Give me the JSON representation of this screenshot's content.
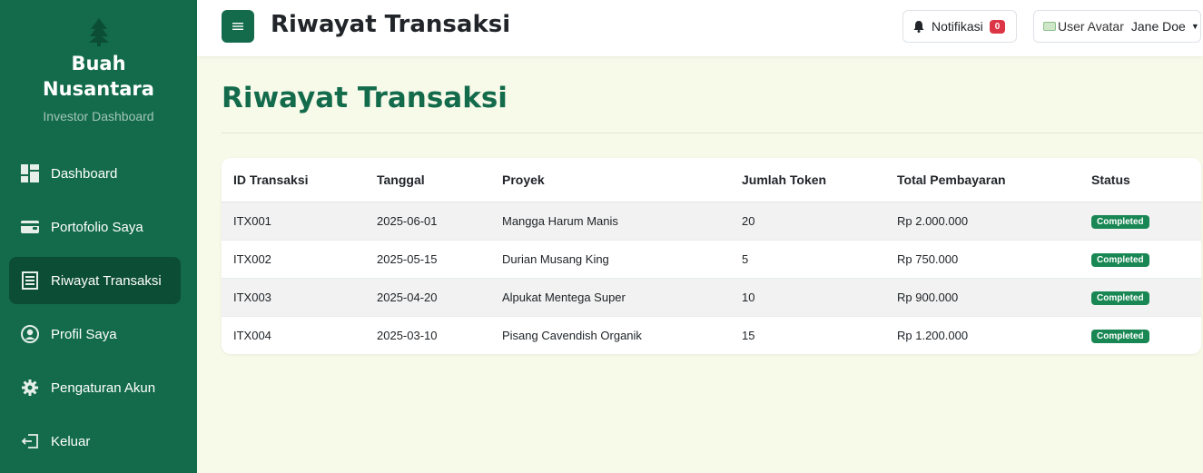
{
  "sidebar": {
    "brand_line1": "Buah",
    "brand_line2": "Nusantara",
    "brand_sub": "Investor Dashboard",
    "items": [
      {
        "label": "Dashboard",
        "icon": "dashboard-icon"
      },
      {
        "label": "Portofolio Saya",
        "icon": "wallet-icon"
      },
      {
        "label": "Riwayat Transaksi",
        "icon": "receipt-icon",
        "active": true
      },
      {
        "label": "Profil Saya",
        "icon": "user-circle-icon"
      },
      {
        "label": "Pengaturan Akun",
        "icon": "gear-icon"
      },
      {
        "label": "Keluar",
        "icon": "logout-icon"
      }
    ]
  },
  "topbar": {
    "title": "Riwayat Transaksi",
    "notif_label": "Notifikasi",
    "notif_count": "0",
    "avatar_alt": "User Avatar",
    "user_name": "Jane Doe"
  },
  "main": {
    "title": "Riwayat Transaksi"
  },
  "table": {
    "headers": [
      "ID Transaksi",
      "Tanggal",
      "Proyek",
      "Jumlah Token",
      "Total Pembayaran",
      "Status"
    ],
    "rows": [
      [
        "ITX001",
        "2025-06-01",
        "Mangga Harum Manis",
        "20",
        "Rp 2.000.000",
        "Completed"
      ],
      [
        "ITX002",
        "2025-05-15",
        "Durian Musang King",
        "5",
        "Rp 750.000",
        "Completed"
      ],
      [
        "ITX003",
        "2025-04-20",
        "Alpukat Mentega Super",
        "10",
        "Rp 900.000",
        "Completed"
      ],
      [
        "ITX004",
        "2025-03-10",
        "Pisang Cavendish Organik",
        "15",
        "Rp 1.200.000",
        "Completed"
      ]
    ]
  },
  "colors": {
    "primary": "#136b4c",
    "active_nav": "#0c4d36",
    "background": "#f7f9e9",
    "status_success": "#198754",
    "badge_danger": "#dc3545"
  }
}
